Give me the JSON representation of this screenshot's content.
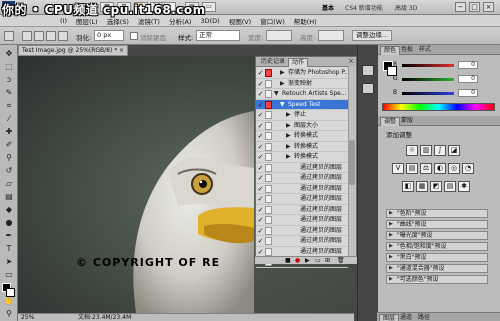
{
  "watermark": "你的 • CPU频道 cpu.it168.com",
  "appbar": {
    "logo": "Ps",
    "zoom": "25%",
    "workspaces": [
      "基本",
      "CS4 新增功能",
      "高级 3D"
    ],
    "window_buttons": [
      "−",
      "□",
      "×"
    ]
  },
  "menubar": [
    "(I)",
    "图层(L)",
    "选择(S)",
    "滤镜(T)",
    "分析(A)",
    "3D(D)",
    "视图(V)",
    "窗口(W)",
    "帮助(H)"
  ],
  "options": {
    "feather_label": "羽化:",
    "feather_value": "0 px",
    "antialias_label": "消除锯齿",
    "style_label": "样式:",
    "style_value": "正常",
    "width_label": "宽度:",
    "height_label": "高度:",
    "refine_button": "调整边缘..."
  },
  "document": {
    "tab_title": "Test Image.jpg @ 25%(RGB/8) *",
    "copyright": "© COPYRIGHT OF RE",
    "status_zoom": "25%",
    "status_doc": "文档:23.4M/23.4M"
  },
  "actions_panel": {
    "tabs": [
      "历史记录",
      "动作"
    ],
    "close": "×",
    "rows": [
      {
        "label": "存储为 Photoshop P...",
        "indent": 2,
        "tri": "▶",
        "dlg": "red",
        "selected": false
      },
      {
        "label": "渐变映射",
        "indent": 2,
        "tri": "▶",
        "dlg": "",
        "selected": false
      },
      {
        "label": "Retouch Artists Spe...",
        "indent": 1,
        "tri": "▼",
        "dlg": "",
        "selected": false
      },
      {
        "label": "Speed Test",
        "indent": 2,
        "tri": "▼",
        "dlg": "red",
        "selected": true
      },
      {
        "label": "停止",
        "indent": 3,
        "tri": "▶",
        "dlg": "",
        "selected": false
      },
      {
        "label": "图层大小",
        "indent": 3,
        "tri": "▶",
        "dlg": "",
        "selected": false
      },
      {
        "label": "转换模式",
        "indent": 3,
        "tri": "▶",
        "dlg": "",
        "selected": false
      },
      {
        "label": "转换模式",
        "indent": 3,
        "tri": "▶",
        "dlg": "",
        "selected": false
      },
      {
        "label": "转换模式",
        "indent": 3,
        "tri": "▶",
        "dlg": "",
        "selected": false
      },
      {
        "label": "通过拷贝的图层",
        "indent": 4,
        "tri": "",
        "dlg": "",
        "selected": false
      },
      {
        "label": "通过拷贝的图层",
        "indent": 4,
        "tri": "",
        "dlg": "",
        "selected": false
      },
      {
        "label": "通过拷贝的图层",
        "indent": 4,
        "tri": "",
        "dlg": "",
        "selected": false
      },
      {
        "label": "通过拷贝的图层",
        "indent": 4,
        "tri": "",
        "dlg": "",
        "selected": false
      },
      {
        "label": "通过拷贝的图层",
        "indent": 4,
        "tri": "",
        "dlg": "",
        "selected": false
      },
      {
        "label": "通过拷贝的图层",
        "indent": 4,
        "tri": "",
        "dlg": "",
        "selected": false
      },
      {
        "label": "通过拷贝的图层",
        "indent": 4,
        "tri": "",
        "dlg": "",
        "selected": false
      },
      {
        "label": "通过拷贝的图层",
        "indent": 4,
        "tri": "",
        "dlg": "",
        "selected": false
      },
      {
        "label": "通过拷贝的图层",
        "indent": 4,
        "tri": "",
        "dlg": "",
        "selected": false
      },
      {
        "label": "通过拷贝的图层",
        "indent": 4,
        "tri": "",
        "dlg": "",
        "selected": false
      }
    ]
  },
  "color_panel": {
    "tabs": [
      "颜色",
      "色板",
      "样式"
    ],
    "channels": [
      {
        "label": "R",
        "value": "0",
        "color": "#e03030"
      },
      {
        "label": "G",
        "value": "0",
        "color": "#30b030"
      },
      {
        "label": "B",
        "value": "0",
        "color": "#3040e0"
      }
    ]
  },
  "adjust_panel": {
    "tabs": [
      "调整",
      "蒙版"
    ],
    "title": "添加调整",
    "presets": [
      "\"色阶\"预设",
      "\"曲线\"预设",
      "\"曝光度\"预设",
      "\"色相/饱和度\"预设",
      "\"黑白\"预设",
      "\"通道混合器\"预设",
      "\"可选颜色\"预设"
    ]
  },
  "bottom_tabs": [
    "图层",
    "通道",
    "路径"
  ]
}
